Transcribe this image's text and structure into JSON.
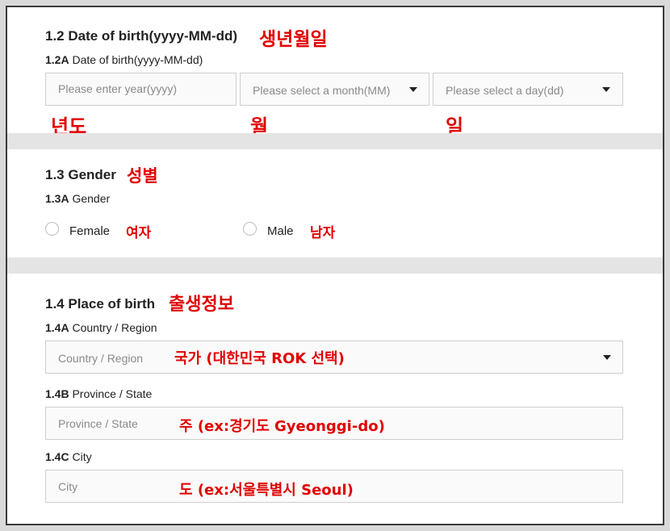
{
  "birth": {
    "title": "1.2 Date of birth(yyyy-MM-dd)",
    "title_ko": "생년월일",
    "field_code": "1.2A",
    "field_label": "Date of birth(yyyy-MM-dd)",
    "year_placeholder": "Please enter year(yyyy)",
    "month_placeholder": "Please select a month(MM)",
    "day_placeholder": "Please select a day(dd)",
    "year_ko": "년도",
    "month_ko": "월",
    "day_ko": "일"
  },
  "gender": {
    "title": "1.3 Gender",
    "title_ko": "성별",
    "field_code": "1.3A",
    "field_label": "Gender",
    "female_label": "Female",
    "female_ko": "여자",
    "male_label": "Male",
    "male_ko": "남자"
  },
  "place": {
    "title": "1.4 Place of birth",
    "title_ko": "출생정보",
    "country": {
      "code": "1.4A",
      "label": "Country / Region",
      "placeholder": "Country / Region",
      "ko": "국가 (대한민국 ROK 선택)"
    },
    "province": {
      "code": "1.4B",
      "label": "Province / State",
      "placeholder": "Province / State",
      "ko": "주 (ex:경기도 Gyeonggi-do)"
    },
    "city": {
      "code": "1.4C",
      "label": "City",
      "placeholder": "City",
      "ko": "도 (ex:서울특별시 Seoul)"
    }
  },
  "colors": {
    "annotation": "#e00000",
    "divider": "#e4e4e4",
    "border": "#cfcfcf",
    "placeholder": "#8a8a8a"
  },
  "icons": [
    "chevron-down-icon",
    "radio-icon"
  ]
}
